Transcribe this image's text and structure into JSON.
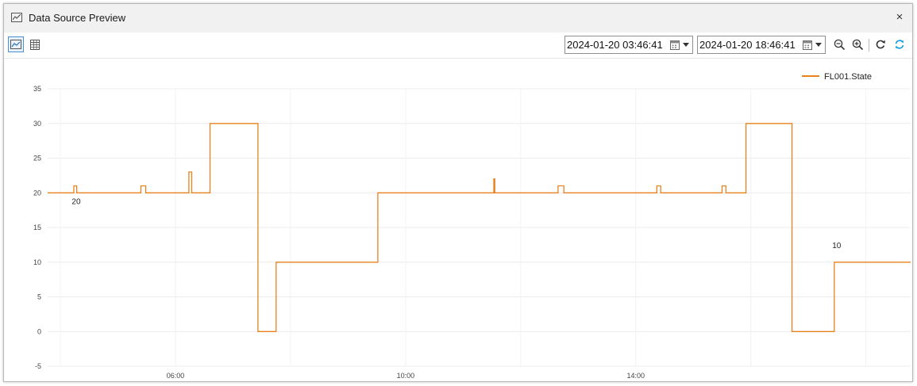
{
  "window": {
    "title": "Data Source Preview",
    "close_label": "×"
  },
  "toolbar": {
    "chart_view_icon": "line-chart-icon",
    "table_view_icon": "table-icon",
    "start_time": "2024-01-20 03:46:41",
    "end_time": "2024-01-20 18:46:41",
    "zoom_out_icon": "zoom-out-icon",
    "zoom_in_icon": "zoom-in-icon",
    "reset_icon": "reset-icon",
    "refresh_icon": "refresh-icon",
    "accent": "#1a9fe0"
  },
  "chart_data": {
    "type": "line",
    "step": true,
    "ylim": [
      -5,
      35
    ],
    "yticks": [
      -5,
      0,
      5,
      10,
      15,
      20,
      25,
      30,
      35
    ],
    "xlim": [
      "03:46:41",
      "18:46:41"
    ],
    "xticks": [
      "06:00",
      "10:00",
      "14:00"
    ],
    "grid": true,
    "legend_position": "top-right",
    "series": [
      {
        "name": "FL001.State",
        "color": "#e8821e",
        "points": [
          [
            "03:46:41",
            20
          ],
          [
            "04:14",
            21
          ],
          [
            "04:17",
            20
          ],
          [
            "05:24",
            21
          ],
          [
            "05:29",
            20
          ],
          [
            "06:14",
            23
          ],
          [
            "06:17",
            20
          ],
          [
            "06:36",
            30
          ],
          [
            "07:26",
            0
          ],
          [
            "07:45",
            10
          ],
          [
            "09:31",
            20
          ],
          [
            "11:32",
            22
          ],
          [
            "11:33",
            20
          ],
          [
            "12:39",
            21
          ],
          [
            "12:45",
            20
          ],
          [
            "14:22",
            21
          ],
          [
            "14:26",
            20
          ],
          [
            "15:30",
            21
          ],
          [
            "15:34",
            20
          ],
          [
            "15:55",
            30
          ],
          [
            "16:43",
            0
          ],
          [
            "17:27",
            10
          ],
          [
            "18:46:41",
            10
          ]
        ]
      }
    ],
    "annotations": [
      {
        "time": "04:14",
        "value": 20,
        "label": "20"
      },
      {
        "time": "17:27",
        "value": 10,
        "label": "10"
      }
    ]
  }
}
